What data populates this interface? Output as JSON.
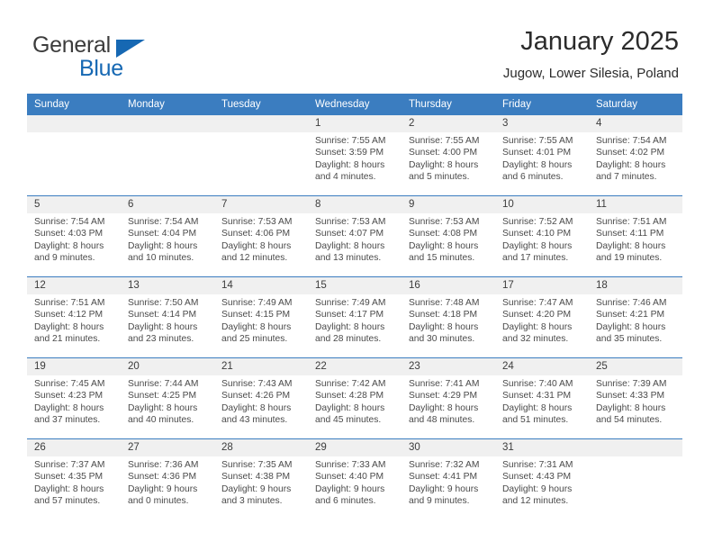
{
  "brand": {
    "name_top": "General",
    "name_bottom": "Blue",
    "triangle_color": "#1668b3",
    "icon": "triangle-flag-icon"
  },
  "header": {
    "title": "January 2025",
    "subtitle": "Jugow, Lower Silesia, Poland"
  },
  "theme": {
    "header_bg": "#3b7dc0",
    "daynum_bg": "#f0f0f0",
    "separator": "#3b7dc0",
    "text": "#3c3c3c"
  },
  "weekdays": [
    "Sunday",
    "Monday",
    "Tuesday",
    "Wednesday",
    "Thursday",
    "Friday",
    "Saturday"
  ],
  "labels": {
    "sunrise_prefix": "Sunrise:",
    "sunset_prefix": "Sunset:",
    "daylight_prefix": "Daylight:"
  },
  "weeks": [
    [
      {
        "empty": true
      },
      {
        "empty": true
      },
      {
        "empty": true
      },
      {
        "day": "1",
        "sunrise": "Sunrise: 7:55 AM",
        "sunset": "Sunset: 3:59 PM",
        "daylight1": "Daylight: 8 hours",
        "daylight2": "and 4 minutes."
      },
      {
        "day": "2",
        "sunrise": "Sunrise: 7:55 AM",
        "sunset": "Sunset: 4:00 PM",
        "daylight1": "Daylight: 8 hours",
        "daylight2": "and 5 minutes."
      },
      {
        "day": "3",
        "sunrise": "Sunrise: 7:55 AM",
        "sunset": "Sunset: 4:01 PM",
        "daylight1": "Daylight: 8 hours",
        "daylight2": "and 6 minutes."
      },
      {
        "day": "4",
        "sunrise": "Sunrise: 7:54 AM",
        "sunset": "Sunset: 4:02 PM",
        "daylight1": "Daylight: 8 hours",
        "daylight2": "and 7 minutes."
      }
    ],
    [
      {
        "day": "5",
        "sunrise": "Sunrise: 7:54 AM",
        "sunset": "Sunset: 4:03 PM",
        "daylight1": "Daylight: 8 hours",
        "daylight2": "and 9 minutes."
      },
      {
        "day": "6",
        "sunrise": "Sunrise: 7:54 AM",
        "sunset": "Sunset: 4:04 PM",
        "daylight1": "Daylight: 8 hours",
        "daylight2": "and 10 minutes."
      },
      {
        "day": "7",
        "sunrise": "Sunrise: 7:53 AM",
        "sunset": "Sunset: 4:06 PM",
        "daylight1": "Daylight: 8 hours",
        "daylight2": "and 12 minutes."
      },
      {
        "day": "8",
        "sunrise": "Sunrise: 7:53 AM",
        "sunset": "Sunset: 4:07 PM",
        "daylight1": "Daylight: 8 hours",
        "daylight2": "and 13 minutes."
      },
      {
        "day": "9",
        "sunrise": "Sunrise: 7:53 AM",
        "sunset": "Sunset: 4:08 PM",
        "daylight1": "Daylight: 8 hours",
        "daylight2": "and 15 minutes."
      },
      {
        "day": "10",
        "sunrise": "Sunrise: 7:52 AM",
        "sunset": "Sunset: 4:10 PM",
        "daylight1": "Daylight: 8 hours",
        "daylight2": "and 17 minutes."
      },
      {
        "day": "11",
        "sunrise": "Sunrise: 7:51 AM",
        "sunset": "Sunset: 4:11 PM",
        "daylight1": "Daylight: 8 hours",
        "daylight2": "and 19 minutes."
      }
    ],
    [
      {
        "day": "12",
        "sunrise": "Sunrise: 7:51 AM",
        "sunset": "Sunset: 4:12 PM",
        "daylight1": "Daylight: 8 hours",
        "daylight2": "and 21 minutes."
      },
      {
        "day": "13",
        "sunrise": "Sunrise: 7:50 AM",
        "sunset": "Sunset: 4:14 PM",
        "daylight1": "Daylight: 8 hours",
        "daylight2": "and 23 minutes."
      },
      {
        "day": "14",
        "sunrise": "Sunrise: 7:49 AM",
        "sunset": "Sunset: 4:15 PM",
        "daylight1": "Daylight: 8 hours",
        "daylight2": "and 25 minutes."
      },
      {
        "day": "15",
        "sunrise": "Sunrise: 7:49 AM",
        "sunset": "Sunset: 4:17 PM",
        "daylight1": "Daylight: 8 hours",
        "daylight2": "and 28 minutes."
      },
      {
        "day": "16",
        "sunrise": "Sunrise: 7:48 AM",
        "sunset": "Sunset: 4:18 PM",
        "daylight1": "Daylight: 8 hours",
        "daylight2": "and 30 minutes."
      },
      {
        "day": "17",
        "sunrise": "Sunrise: 7:47 AM",
        "sunset": "Sunset: 4:20 PM",
        "daylight1": "Daylight: 8 hours",
        "daylight2": "and 32 minutes."
      },
      {
        "day": "18",
        "sunrise": "Sunrise: 7:46 AM",
        "sunset": "Sunset: 4:21 PM",
        "daylight1": "Daylight: 8 hours",
        "daylight2": "and 35 minutes."
      }
    ],
    [
      {
        "day": "19",
        "sunrise": "Sunrise: 7:45 AM",
        "sunset": "Sunset: 4:23 PM",
        "daylight1": "Daylight: 8 hours",
        "daylight2": "and 37 minutes."
      },
      {
        "day": "20",
        "sunrise": "Sunrise: 7:44 AM",
        "sunset": "Sunset: 4:25 PM",
        "daylight1": "Daylight: 8 hours",
        "daylight2": "and 40 minutes."
      },
      {
        "day": "21",
        "sunrise": "Sunrise: 7:43 AM",
        "sunset": "Sunset: 4:26 PM",
        "daylight1": "Daylight: 8 hours",
        "daylight2": "and 43 minutes."
      },
      {
        "day": "22",
        "sunrise": "Sunrise: 7:42 AM",
        "sunset": "Sunset: 4:28 PM",
        "daylight1": "Daylight: 8 hours",
        "daylight2": "and 45 minutes."
      },
      {
        "day": "23",
        "sunrise": "Sunrise: 7:41 AM",
        "sunset": "Sunset: 4:29 PM",
        "daylight1": "Daylight: 8 hours",
        "daylight2": "and 48 minutes."
      },
      {
        "day": "24",
        "sunrise": "Sunrise: 7:40 AM",
        "sunset": "Sunset: 4:31 PM",
        "daylight1": "Daylight: 8 hours",
        "daylight2": "and 51 minutes."
      },
      {
        "day": "25",
        "sunrise": "Sunrise: 7:39 AM",
        "sunset": "Sunset: 4:33 PM",
        "daylight1": "Daylight: 8 hours",
        "daylight2": "and 54 minutes."
      }
    ],
    [
      {
        "day": "26",
        "sunrise": "Sunrise: 7:37 AM",
        "sunset": "Sunset: 4:35 PM",
        "daylight1": "Daylight: 8 hours",
        "daylight2": "and 57 minutes."
      },
      {
        "day": "27",
        "sunrise": "Sunrise: 7:36 AM",
        "sunset": "Sunset: 4:36 PM",
        "daylight1": "Daylight: 9 hours",
        "daylight2": "and 0 minutes."
      },
      {
        "day": "28",
        "sunrise": "Sunrise: 7:35 AM",
        "sunset": "Sunset: 4:38 PM",
        "daylight1": "Daylight: 9 hours",
        "daylight2": "and 3 minutes."
      },
      {
        "day": "29",
        "sunrise": "Sunrise: 7:33 AM",
        "sunset": "Sunset: 4:40 PM",
        "daylight1": "Daylight: 9 hours",
        "daylight2": "and 6 minutes."
      },
      {
        "day": "30",
        "sunrise": "Sunrise: 7:32 AM",
        "sunset": "Sunset: 4:41 PM",
        "daylight1": "Daylight: 9 hours",
        "daylight2": "and 9 minutes."
      },
      {
        "day": "31",
        "sunrise": "Sunrise: 7:31 AM",
        "sunset": "Sunset: 4:43 PM",
        "daylight1": "Daylight: 9 hours",
        "daylight2": "and 12 minutes."
      },
      {
        "empty": true
      }
    ]
  ]
}
